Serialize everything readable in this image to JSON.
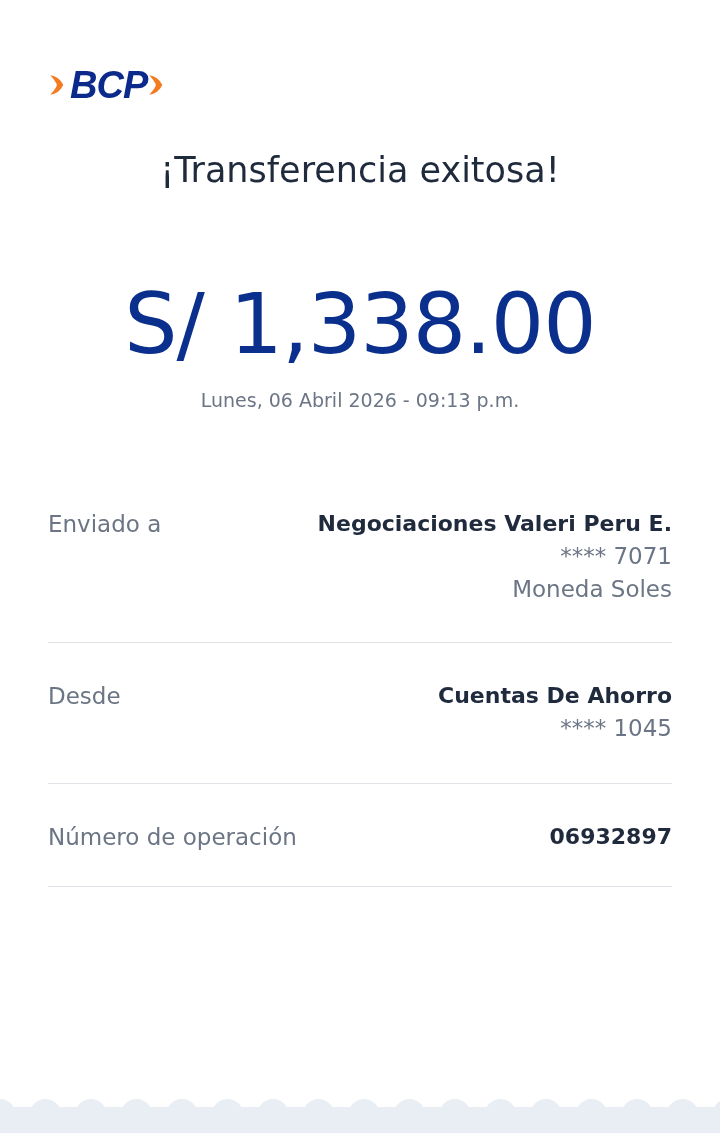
{
  "logo": {
    "text": "BCP"
  },
  "title": "¡Transferencia exitosa!",
  "amount": "S/ 1,338.00",
  "date": "Lunes, 06 Abril 2026 - 09:13 p.m.",
  "details": [
    {
      "label": "Enviado a",
      "value": "Negociaciones Valeri Peru E.",
      "extra": [
        "**** 7071",
        "Moneda Soles"
      ]
    },
    {
      "label": "Desde",
      "value": "Cuentas De Ahorro",
      "extra": [
        "**** 1045"
      ]
    },
    {
      "label": "Número de operación",
      "value": "06932897"
    }
  ]
}
